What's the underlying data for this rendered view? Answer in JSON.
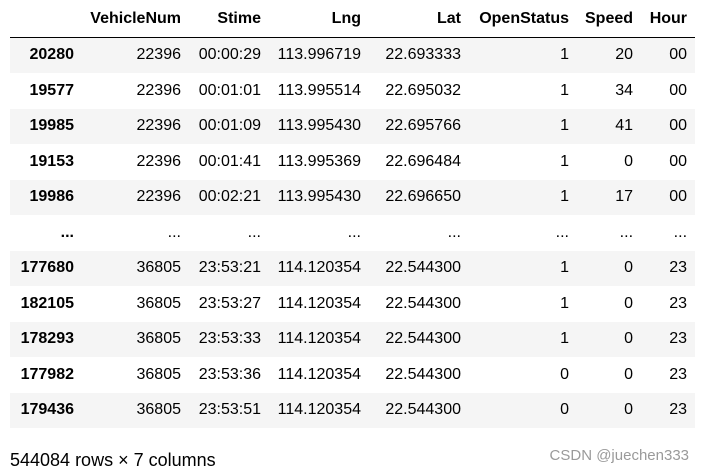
{
  "dataframe": {
    "columns": [
      "VehicleNum",
      "Stime",
      "Lng",
      "Lat",
      "OpenStatus",
      "Speed",
      "Hour"
    ],
    "rows": [
      {
        "index": "20280",
        "cells": [
          "22396",
          "00:00:29",
          "113.996719",
          "22.693333",
          "1",
          "20",
          "00"
        ]
      },
      {
        "index": "19577",
        "cells": [
          "22396",
          "00:01:01",
          "113.995514",
          "22.695032",
          "1",
          "34",
          "00"
        ]
      },
      {
        "index": "19985",
        "cells": [
          "22396",
          "00:01:09",
          "113.995430",
          "22.695766",
          "1",
          "41",
          "00"
        ]
      },
      {
        "index": "19153",
        "cells": [
          "22396",
          "00:01:41",
          "113.995369",
          "22.696484",
          "1",
          "0",
          "00"
        ]
      },
      {
        "index": "19986",
        "cells": [
          "22396",
          "00:02:21",
          "113.995430",
          "22.696650",
          "1",
          "17",
          "00"
        ]
      },
      {
        "index": "...",
        "cells": [
          "...",
          "...",
          "...",
          "...",
          "...",
          "...",
          "..."
        ]
      },
      {
        "index": "177680",
        "cells": [
          "36805",
          "23:53:21",
          "114.120354",
          "22.544300",
          "1",
          "0",
          "23"
        ]
      },
      {
        "index": "182105",
        "cells": [
          "36805",
          "23:53:27",
          "114.120354",
          "22.544300",
          "1",
          "0",
          "23"
        ]
      },
      {
        "index": "178293",
        "cells": [
          "36805",
          "23:53:33",
          "114.120354",
          "22.544300",
          "1",
          "0",
          "23"
        ]
      },
      {
        "index": "177982",
        "cells": [
          "36805",
          "23:53:36",
          "114.120354",
          "22.544300",
          "0",
          "0",
          "23"
        ]
      },
      {
        "index": "179436",
        "cells": [
          "36805",
          "23:53:51",
          "114.120354",
          "22.544300",
          "0",
          "0",
          "23"
        ]
      }
    ],
    "shape_text": "544084 rows × 7 columns"
  },
  "watermark": "CSDN @juechen333"
}
